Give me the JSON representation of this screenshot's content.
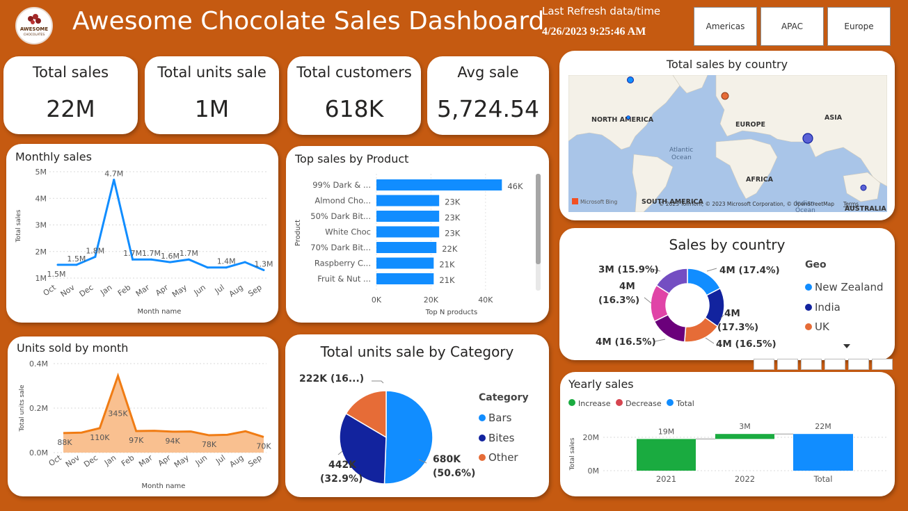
{
  "header": {
    "title": "Awesome Chocolate Sales Dashboard",
    "logo_line1": "AWESOME",
    "logo_line2": "CHOCOLATES",
    "refresh_label": "Last Refresh data/time",
    "refresh_value": "4/26/2023 9:25:46 AM",
    "regions": [
      "Americas",
      "APAC",
      "Europe"
    ]
  },
  "kpis": [
    {
      "label": "Total sales",
      "value": "22M"
    },
    {
      "label": "Total units sale",
      "value": "1M"
    },
    {
      "label": "Total customers",
      "value": "618K"
    },
    {
      "label": "Avg sale",
      "value": "5,724.54"
    }
  ],
  "monthly_sales": {
    "chart_data": {
      "type": "line",
      "title": "Monthly sales",
      "xlabel": "Month name",
      "ylabel": "Total sales",
      "categories": [
        "Oct",
        "Nov",
        "Dec",
        "Jan",
        "Feb",
        "Mar",
        "Apr",
        "May",
        "Jun",
        "Jul",
        "Aug",
        "Sep"
      ],
      "values": [
        1.5,
        1.5,
        1.8,
        4.7,
        1.7,
        1.7,
        1.6,
        1.7,
        1.4,
        1.4,
        1.6,
        1.3
      ],
      "data_labels": [
        "1.5M",
        "1.5M",
        "1.8M",
        "4.7M",
        "1.7M",
        "1.7M",
        "1.6M",
        "1.7M",
        "",
        "1.4M",
        "",
        "1.3M"
      ],
      "yticks": [
        "1M",
        "2M",
        "3M",
        "4M",
        "5M"
      ],
      "ylim": [
        1,
        5
      ],
      "color": "#118dff"
    }
  },
  "top_products": {
    "chart_data": {
      "type": "bar",
      "title": "Top sales by Product",
      "xlabel": "Top N products",
      "ylabel": "Product",
      "categories": [
        "99% Dark & ...",
        "Almond Cho...",
        "50% Dark Bit...",
        "White Choc",
        "70% Dark Bit...",
        "Raspberry C...",
        "Fruit & Nut ..."
      ],
      "values": [
        46,
        23,
        23,
        23,
        22,
        21,
        21
      ],
      "data_labels": [
        "46K",
        "23K",
        "23K",
        "23K",
        "22K",
        "21K",
        "21K"
      ],
      "xticks": [
        "0K",
        "20K",
        "40K"
      ],
      "xlim": [
        0,
        50
      ],
      "color": "#118dff"
    }
  },
  "map": {
    "title": "Total sales by country",
    "labels": {
      "north_america": "NORTH AMERICA",
      "south_america": "SOUTH AMERICA",
      "europe": "EUROPE",
      "africa": "AFRICA",
      "asia": "ASIA",
      "australia": "AUSTRALIA",
      "atlantic": "Atlantic\nOcean",
      "indian": "Indian\nOcean"
    },
    "bing": "Microsoft Bing",
    "attribution": "© 2023 TomTom, © 2023 Microsoft Corporation, © OpenStreetMap",
    "terms": "Terms"
  },
  "sales_by_country": {
    "legend_title": "Geo",
    "chart_data": {
      "type": "pie",
      "title": "Sales by country",
      "series": [
        {
          "name": "New Zealand",
          "value": 17.4,
          "label": "4M (17.4%)",
          "color": "#118dff"
        },
        {
          "name": "India",
          "value": 17.3,
          "label": "4M (17.3%)",
          "color": "#12239e"
        },
        {
          "name": "UK",
          "value": 16.5,
          "label": "4M (16.5%)",
          "color": "#e66c37"
        },
        {
          "name": "",
          "value": 16.5,
          "label": "4M (16.5%)",
          "color": "#6b007b"
        },
        {
          "name": "",
          "value": 16.3,
          "label": "4M (16.3%)",
          "color": "#e044a7"
        },
        {
          "name": "",
          "value": 15.9,
          "label": "3M (15.9%)",
          "color": "#744ec2"
        }
      ]
    }
  },
  "units_by_month": {
    "chart_data": {
      "type": "area",
      "title": "Units sold by month",
      "xlabel": "Month name",
      "ylabel": "Total units sale",
      "categories": [
        "Oct",
        "Nov",
        "Dec",
        "Jan",
        "Feb",
        "Mar",
        "Apr",
        "May",
        "Jun",
        "Jul",
        "Aug",
        "Sep"
      ],
      "values": [
        88,
        90,
        110,
        345,
        97,
        98,
        94,
        95,
        78,
        80,
        96,
        70
      ],
      "data_labels": [
        "88K",
        "",
        "110K",
        "345K",
        "97K",
        "",
        "94K",
        "",
        "78K",
        "",
        "",
        "70K"
      ],
      "yticks": [
        "0.0M",
        "0.2M",
        "0.4M"
      ],
      "ylim": [
        0,
        400
      ],
      "color": "#f07c14"
    }
  },
  "units_by_category": {
    "legend_title": "Category",
    "chart_data": {
      "type": "pie",
      "title": "Total units sale by Category",
      "series": [
        {
          "name": "Bars",
          "value": 50.6,
          "label": "680K (50.6%)",
          "color": "#118dff"
        },
        {
          "name": "Bites",
          "value": 32.9,
          "label": "442K (32.9%)",
          "color": "#12239e"
        },
        {
          "name": "Other",
          "value": 16.5,
          "label": "222K (16...)",
          "color": "#e66c37"
        }
      ]
    }
  },
  "yearly_sales": {
    "legend": [
      {
        "label": "Increase",
        "color": "#1aab40"
      },
      {
        "label": "Decrease",
        "color": "#d64550"
      },
      {
        "label": "Total",
        "color": "#118dff"
      }
    ],
    "chart_data": {
      "type": "bar",
      "title": "Yearly sales",
      "ylabel": "Total sales",
      "categories": [
        "2021",
        "2022",
        "Total"
      ],
      "values": [
        19,
        3,
        22
      ],
      "data_labels": [
        "19M",
        "3M",
        "22M"
      ],
      "yticks": [
        "0M",
        "20M"
      ],
      "ylim": [
        0,
        25
      ]
    }
  }
}
